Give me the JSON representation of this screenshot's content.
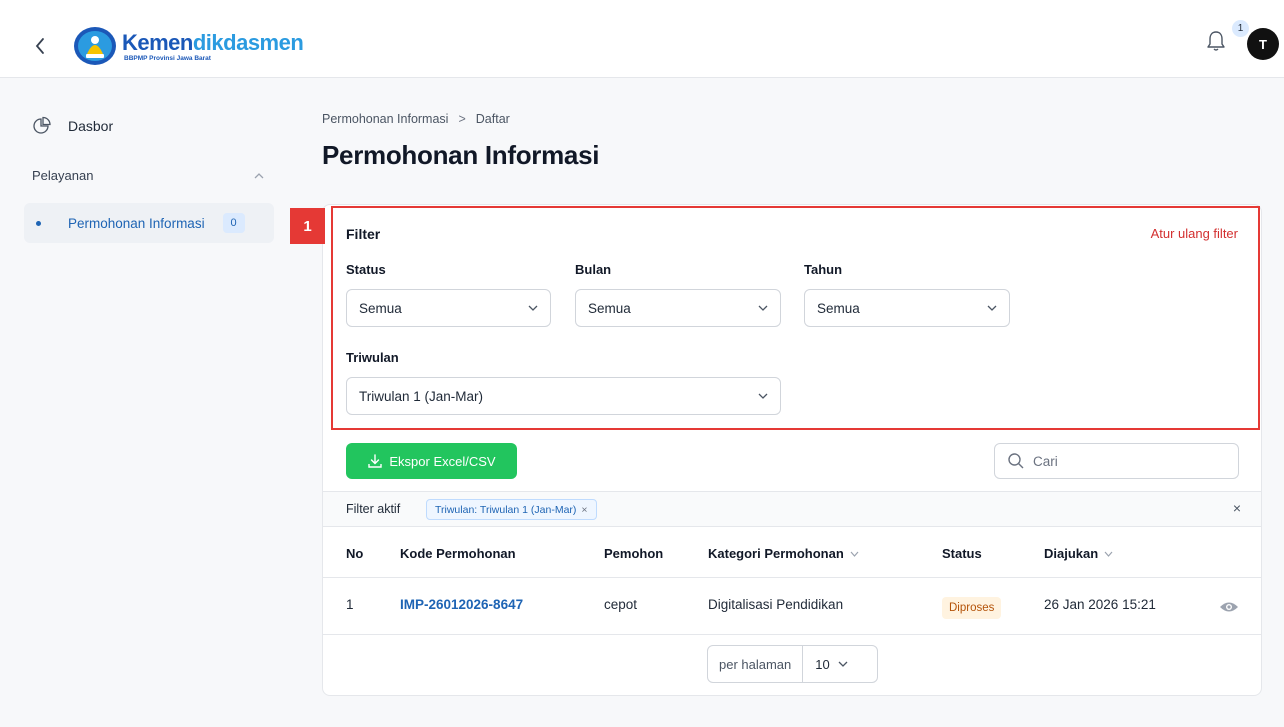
{
  "header": {
    "logo_title_a": "Kemen",
    "logo_title_b": "dikdasmen",
    "logo_subtitle": "BBPMP Provinsi Jawa Barat",
    "notification_count": "1",
    "avatar_initial": "T"
  },
  "sidebar": {
    "items": [
      {
        "label": "Dasbor",
        "icon": "pie-chart-icon"
      }
    ],
    "section": {
      "label": "Pelayanan",
      "icon": "chevron-up-icon"
    },
    "section_items": [
      {
        "label": "Permohonan Informasi",
        "count": "0"
      }
    ]
  },
  "breadcrumb": {
    "parent": "Permohonan Informasi",
    "separator": ">",
    "current": "Daftar"
  },
  "page_title": "Permohonan Informasi",
  "annotation_marker": "1",
  "filter": {
    "title": "Filter",
    "reset_label": "Atur ulang filter",
    "status": {
      "label": "Status",
      "value": "Semua"
    },
    "bulan": {
      "label": "Bulan",
      "value": "Semua"
    },
    "tahun": {
      "label": "Tahun",
      "value": "Semua"
    },
    "triwulan": {
      "label": "Triwulan",
      "value": "Triwulan 1 (Jan-Mar)"
    }
  },
  "toolbar": {
    "export_label": "Ekspor Excel/CSV",
    "search_placeholder": "Cari"
  },
  "active_filters": {
    "label": "Filter aktif",
    "chips": [
      "Triwulan: Triwulan 1 (Jan-Mar)"
    ],
    "chip_remove": "×",
    "clear_all": "×"
  },
  "table": {
    "columns": [
      "No",
      "Kode Permohonan",
      "Pemohon",
      "Kategori Permohonan",
      "Status",
      "Diajukan"
    ],
    "rows": [
      {
        "no": "1",
        "kode": "IMP-26012026-8647",
        "pemohon": "cepot",
        "kategori": "Digitalisasi Pendidikan",
        "status": "Diproses",
        "diajukan": "26 Jan 2026 15:21"
      }
    ]
  },
  "pagination": {
    "label": "per halaman",
    "value": "10"
  },
  "colors": {
    "brand_blue": "#1b58b8",
    "brand_light_blue": "#2b9be0",
    "link": "#1e64b4",
    "export_green": "#22c55e",
    "highlight_red": "#e53935",
    "status_processing": "#b45309"
  }
}
